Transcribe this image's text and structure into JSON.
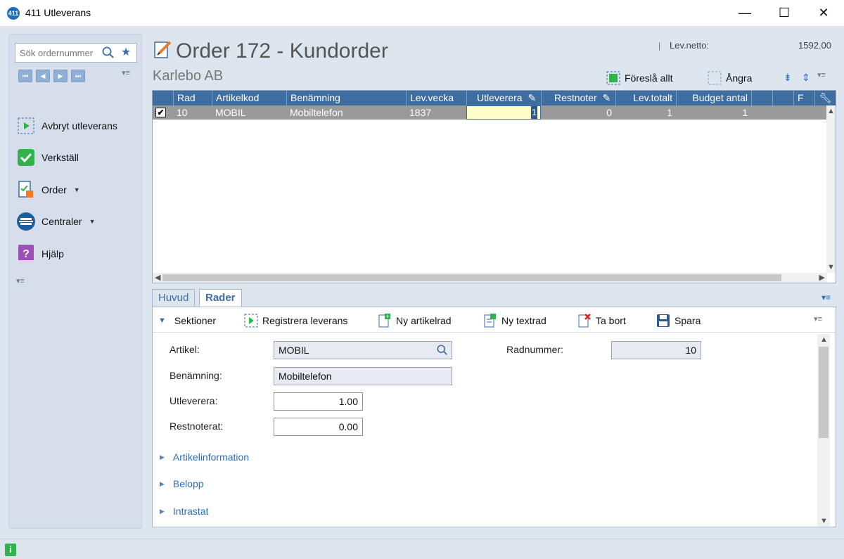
{
  "window": {
    "app_badge": "411",
    "title": "411 Utleverans",
    "minimize": "—",
    "maximize": "☐",
    "close": "✕"
  },
  "sidebar": {
    "search_placeholder": "Sök ordernummer",
    "nav": [
      "⏮",
      "◀",
      "▶",
      "⏭"
    ],
    "items": [
      {
        "label": "Avbryt utleverans",
        "icon": "play-icon"
      },
      {
        "label": "Verkställ",
        "icon": "check-icon"
      },
      {
        "label": "Order",
        "icon": "order-icon",
        "has_dropdown": true
      },
      {
        "label": "Centraler",
        "icon": "central-icon",
        "has_dropdown": true
      },
      {
        "label": "Hjälp",
        "icon": "help-icon"
      }
    ]
  },
  "header": {
    "title": "Order 172 - Kundorder",
    "customer": "Karlebo AB",
    "levnetto_label": "Lev.netto:",
    "levnetto_value": "1592.00",
    "actions": {
      "suggest_all": "Föreslå allt",
      "undo": "Ångra"
    }
  },
  "grid": {
    "columns": [
      "Rad",
      "Artikelkod",
      "Benämning",
      "Lev.vecka",
      "Utleverera",
      "Restnoter",
      "Lev.totalt",
      "Budget antal",
      "F"
    ],
    "rows": [
      {
        "checked": true,
        "rad": "10",
        "artikelkod": "MOBIL",
        "benamning": "Mobiltelefon",
        "levvecka": "1837",
        "utleverera": "1",
        "restnoter": "0",
        "levtotalt": "1",
        "budget": "1"
      }
    ]
  },
  "tabs": [
    {
      "label": "Huvud",
      "active": false
    },
    {
      "label": "Rader",
      "active": true
    }
  ],
  "panel_toolbar": {
    "sections": "Sektioner",
    "register": "Registrera leverans",
    "new_article": "Ny artikelrad",
    "new_text": "Ny textrad",
    "delete": "Ta bort",
    "save": "Spara"
  },
  "form": {
    "artikel_label": "Artikel:",
    "artikel_value": "MOBIL",
    "benamning_label": "Benämning:",
    "benamning_value": "Mobiltelefon",
    "utleverera_label": "Utleverera:",
    "utleverera_value": "1.00",
    "restnoterat_label": "Restnoterat:",
    "restnoterat_value": "0.00",
    "radnummer_label": "Radnummer:",
    "radnummer_value": "10"
  },
  "sections": [
    "Artikelinformation",
    "Belopp",
    "Intrastat"
  ],
  "colors": {
    "accent": "#3e6da0",
    "selected_row": "#9a9a9a",
    "link": "#2a6cbf",
    "green": "#2fb34a"
  }
}
